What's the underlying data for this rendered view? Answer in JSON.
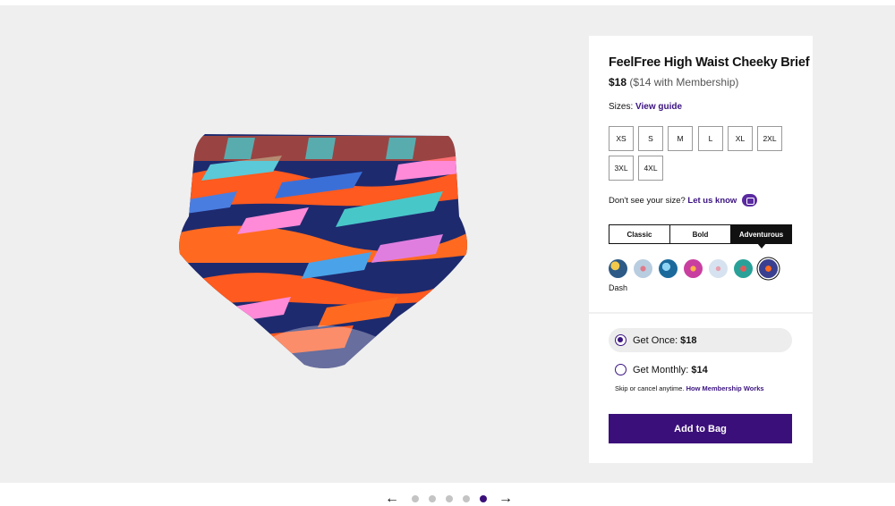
{
  "product": {
    "title": "FeelFree High Waist Cheeky Brief",
    "price": "$18",
    "member_price": "($14 with Membership)"
  },
  "sizes": {
    "label": "Sizes:",
    "guide_link": "View guide",
    "options": [
      "XS",
      "S",
      "M",
      "L",
      "XL",
      "2XL",
      "3XL",
      "4XL"
    ]
  },
  "size_help": {
    "text": "Don't see your size?",
    "link": "Let us know",
    "icon": "chat-icon"
  },
  "style_tabs": [
    "Classic",
    "Bold",
    "Adventurous"
  ],
  "active_style_tab": "Adventurous",
  "swatches": {
    "selected_name": "Dash",
    "colors": [
      "#2d5a86",
      "#b9cde0",
      "#1c6a9c",
      "#c93fa0",
      "#d6e2ef",
      "#2aa198",
      "#3a3f8f"
    ]
  },
  "purchase": {
    "once_label": "Get Once:",
    "once_price": "$18",
    "monthly_label": "Get Monthly:",
    "monthly_price": "$14",
    "skip_text": "Skip or cancel anytime.",
    "membership_link": "How Membership Works",
    "add_button": "Add to Bag"
  },
  "carousel": {
    "prev_icon": "arrow-left-icon",
    "next_icon": "arrow-right-icon",
    "slide_count": 5,
    "active_index": 4
  },
  "colors": {
    "accent": "#3b0f7a",
    "background": "#efefef"
  }
}
